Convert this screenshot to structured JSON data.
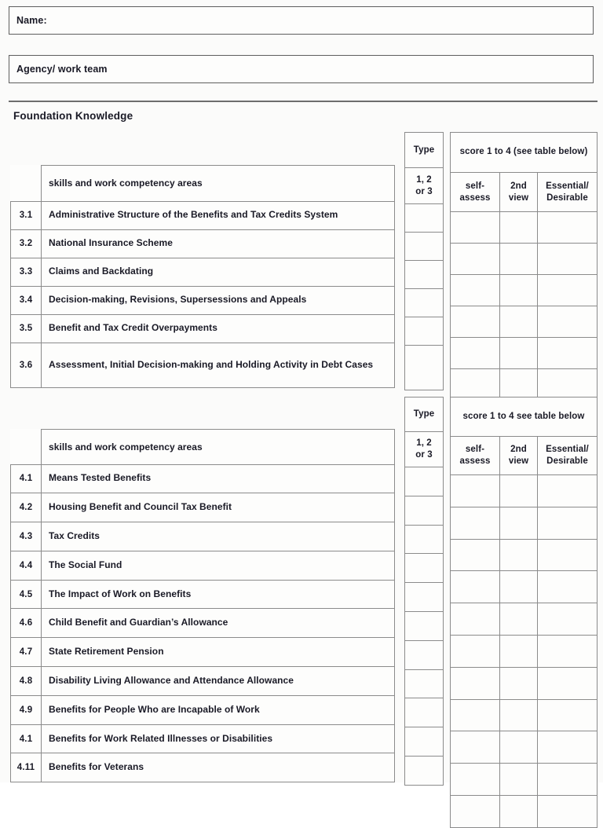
{
  "form": {
    "name_label": "Name:",
    "agency_label": "Agency/ work team",
    "section_heading": "Foundation Knowledge"
  },
  "table1": {
    "type_header": "Type",
    "type_sub": "1, 2\nor 3",
    "type_sub_line1": "1, 2",
    "type_sub_line2": "or 3",
    "score_header": "score 1 to 4 (see table below)",
    "score_cols": [
      "self-assess",
      "2nd view",
      "Essential/ Desirable"
    ],
    "score_col_self_l1": "self-",
    "score_col_self_l2": "assess",
    "score_col_2nd_l1": "2nd",
    "score_col_2nd_l2": "view",
    "score_col_ess_l1": "Essential/",
    "score_col_ess_l2": "Desirable",
    "skills_header": "skills and work competency areas",
    "rows": [
      {
        "num": "3.1",
        "skill": "Administrative Structure of the Benefits and Tax Credits System"
      },
      {
        "num": "3.2",
        "skill": "National Insurance Scheme"
      },
      {
        "num": "3.3",
        "skill": "Claims and Backdating"
      },
      {
        "num": "3.4",
        "skill": "Decision-making, Revisions, Supersessions and Appeals"
      },
      {
        "num": "3.5",
        "skill": "Benefit and Tax Credit Overpayments"
      },
      {
        "num": "3.6",
        "skill": "Assessment, Initial Decision-making and Holding Activity in Debt Cases"
      }
    ]
  },
  "table2": {
    "type_header": "Type",
    "type_sub_line1": "1, 2",
    "type_sub_line2": "or 3",
    "score_header": "score 1 to 4 see table below",
    "score_col_self_l1": "self-",
    "score_col_self_l2": "assess",
    "score_col_2nd_l1": "2nd",
    "score_col_2nd_l2": "view",
    "score_col_ess_l1": "Essential/",
    "score_col_ess_l2": "Desirable",
    "skills_header": "skills and work competency areas",
    "rows": [
      {
        "num": "4.1",
        "skill": "Means Tested Benefits"
      },
      {
        "num": "4.2",
        "skill": "Housing Benefit and Council Tax Benefit"
      },
      {
        "num": "4.3",
        "skill": "Tax Credits"
      },
      {
        "num": "4.4",
        "skill": "The Social Fund"
      },
      {
        "num": "4.5",
        "skill": "The Impact of Work on Benefits"
      },
      {
        "num": "4.6",
        "skill": "Child Benefit and Guardian’s Allowance"
      },
      {
        "num": "4.7",
        "skill": "State Retirement Pension"
      },
      {
        "num": "4.8",
        "skill": "Disability Living Allowance and Attendance Allowance"
      },
      {
        "num": "4.9",
        "skill": "Benefits for People Who are Incapable of Work"
      },
      {
        "num": "4.1",
        "skill": "Benefits for Work Related Illnesses or Disabilities"
      },
      {
        "num": "4.11",
        "skill": "Benefits for Veterans"
      }
    ]
  }
}
